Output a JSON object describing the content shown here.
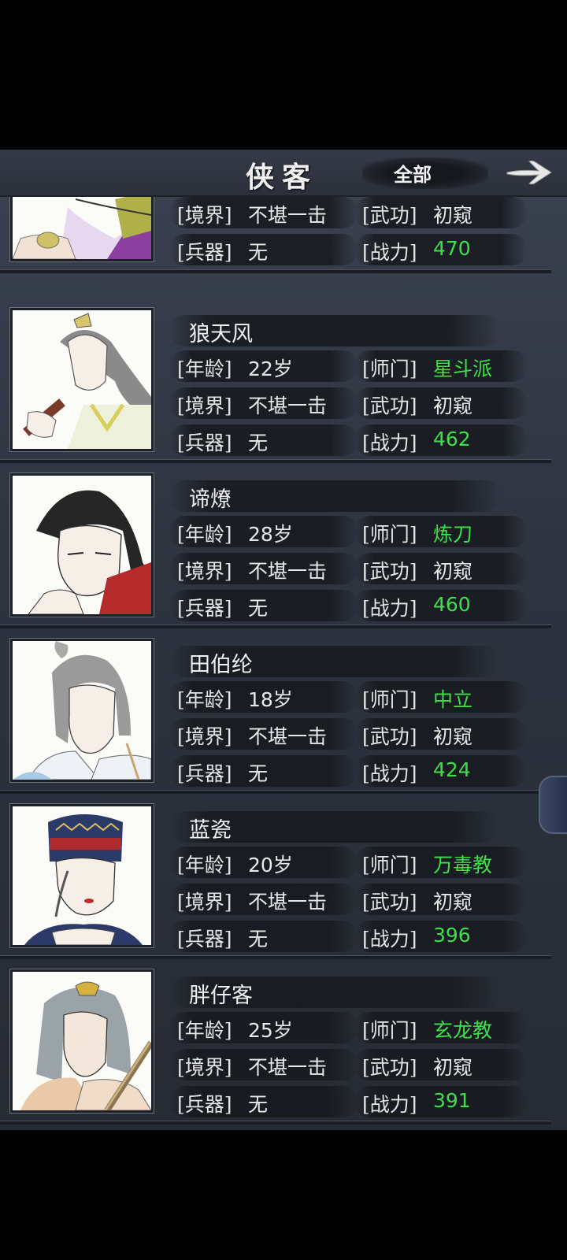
{
  "header": {
    "title": "侠客",
    "filter_label": "全部"
  },
  "labels": {
    "age": "[年龄]",
    "sect": "[师门]",
    "realm": "[境界]",
    "skill": "[武功]",
    "weapon": "[兵器]",
    "power": "[战力]"
  },
  "partial_top": {
    "realm": "不堪一击",
    "skill": "初窥",
    "weapon": "无",
    "power": "470"
  },
  "heroes": [
    {
      "name": "狼天风",
      "age": "22岁",
      "sect": "星斗派",
      "realm": "不堪一击",
      "skill": "初窥",
      "weapon": "无",
      "power": "462"
    },
    {
      "name": "谛燎",
      "age": "28岁",
      "sect": "炼刀",
      "realm": "不堪一击",
      "skill": "初窥",
      "weapon": "无",
      "power": "460"
    },
    {
      "name": "田伯纶",
      "age": "18岁",
      "sect": "中立",
      "realm": "不堪一击",
      "skill": "初窥",
      "weapon": "无",
      "power": "424"
    },
    {
      "name": "蓝瓷",
      "age": "20岁",
      "sect": "万毒教",
      "realm": "不堪一击",
      "skill": "初窥",
      "weapon": "无",
      "power": "396"
    },
    {
      "name": "胖仔客",
      "age": "25岁",
      "sect": "玄龙教",
      "realm": "不堪一击",
      "skill": "初窥",
      "weapon": "无",
      "power": "391"
    }
  ],
  "colors": {
    "highlight_green": "#3ee04a",
    "panel_bg": "#2e3440"
  }
}
